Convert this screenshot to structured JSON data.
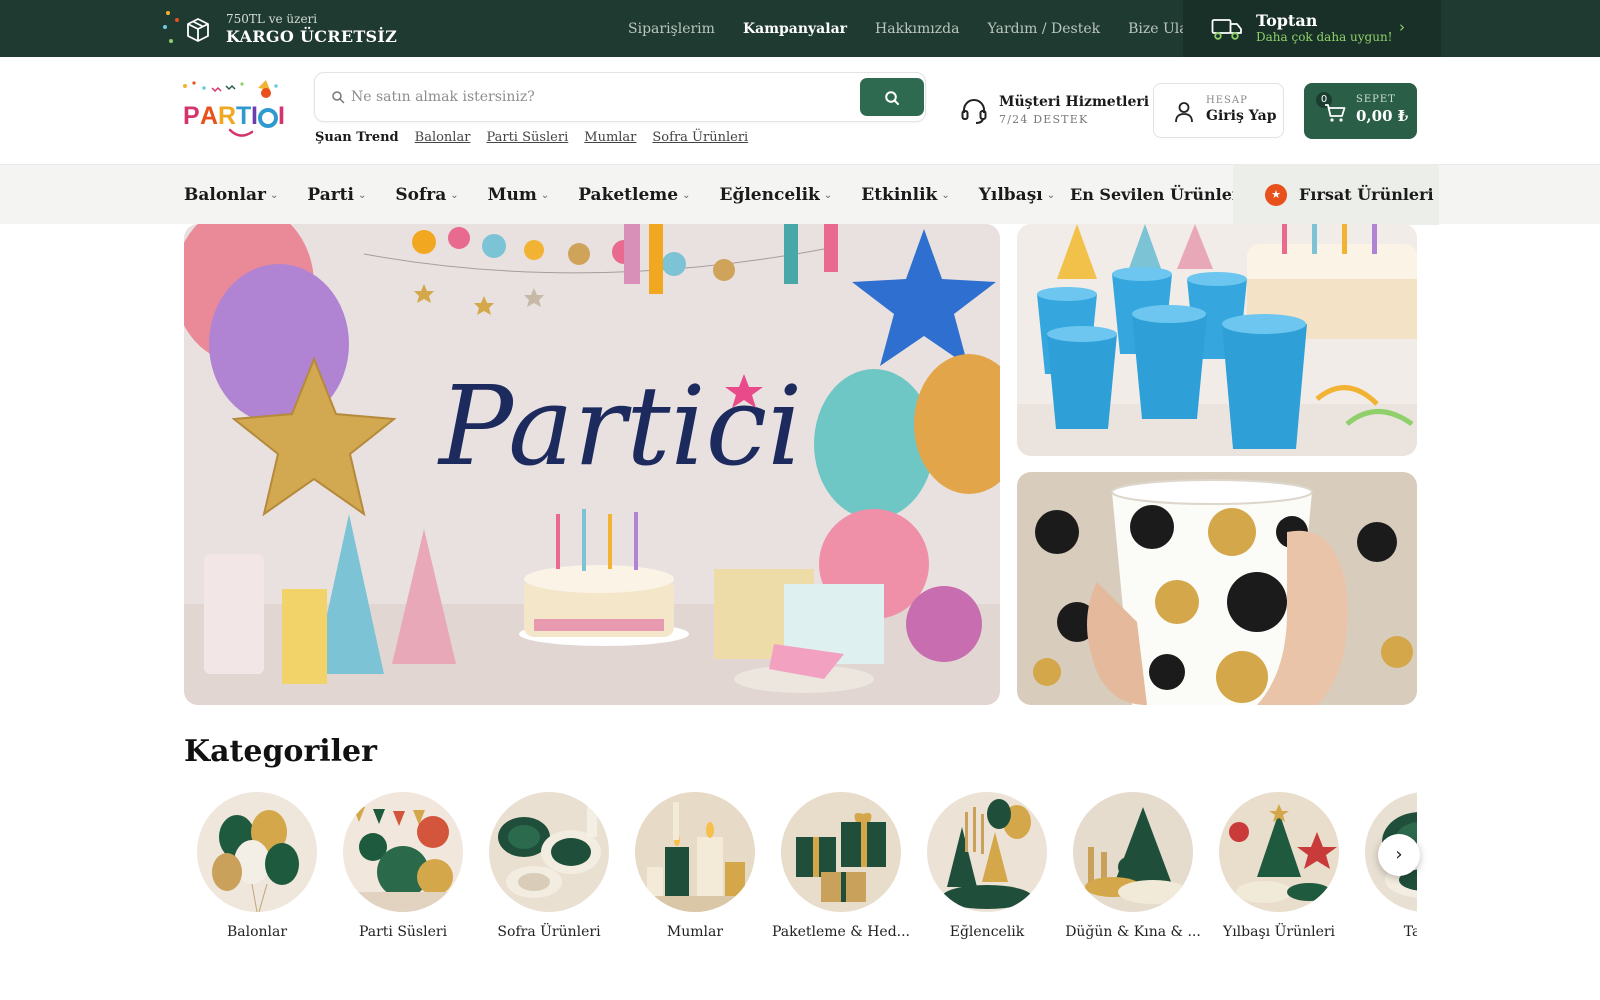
{
  "topbar": {
    "shipping_line1": "750TL ve üzeri",
    "shipping_line2": "KARGO ÜCRETSİZ",
    "links": [
      "Siparişlerim",
      "Kampanyalar",
      "Hakkımızda",
      "Yardım / Destek",
      "Bize Ulaşın"
    ],
    "active_link": "Kampanyalar",
    "wholesale_title": "Toptan",
    "wholesale_sub": "Daha çok daha uygun!"
  },
  "header": {
    "logo_text": "PARTICI",
    "search_placeholder": "Ne satın almak istersiniz?",
    "trend_title": "Şuan Trend",
    "trend_links": [
      "Balonlar",
      "Parti Süsleri",
      "Mumlar",
      "Sofra Ürünleri"
    ],
    "support_title": "Müşteri Hizmetleri",
    "support_sub": "7/24 DESTEK",
    "account_caption": "HESAP",
    "account_label": "Giriş Yap",
    "cart_count": "0",
    "cart_caption": "SEPET",
    "cart_total": "0,00 ₺"
  },
  "nav": {
    "items": [
      "Balonlar",
      "Parti",
      "Sofra",
      "Mum",
      "Paketleme",
      "Eğlencelik",
      "Etkinlik",
      "Yılbaşı"
    ],
    "favorites": "En Sevilen Ürünler",
    "deals": "Fırsat Ürünleri"
  },
  "banners": {
    "main_brand": "Partici"
  },
  "categories": {
    "title": "Kategoriler",
    "items": [
      "Balonlar",
      "Parti Süsleri",
      "Sofra Ürünleri",
      "Mumlar",
      "Paketleme & Hed...",
      "Eğlencelik",
      "Düğün & Kına & ...",
      "Yılbaşı Ürünleri",
      "Tabak"
    ]
  },
  "colors": {
    "topbar_bg": "#1f3a30",
    "brand_green": "#2a5e47",
    "accent_orange": "#e8501c",
    "wholesale_accent": "#8fd06a"
  },
  "icons": {
    "shipping": "box-icon",
    "wholesale": "truck-icon",
    "search": "search-icon",
    "support": "headset-icon",
    "account": "user-icon",
    "cart": "cart-icon",
    "deals": "star-icon",
    "scroll": "chevron-right-icon"
  }
}
